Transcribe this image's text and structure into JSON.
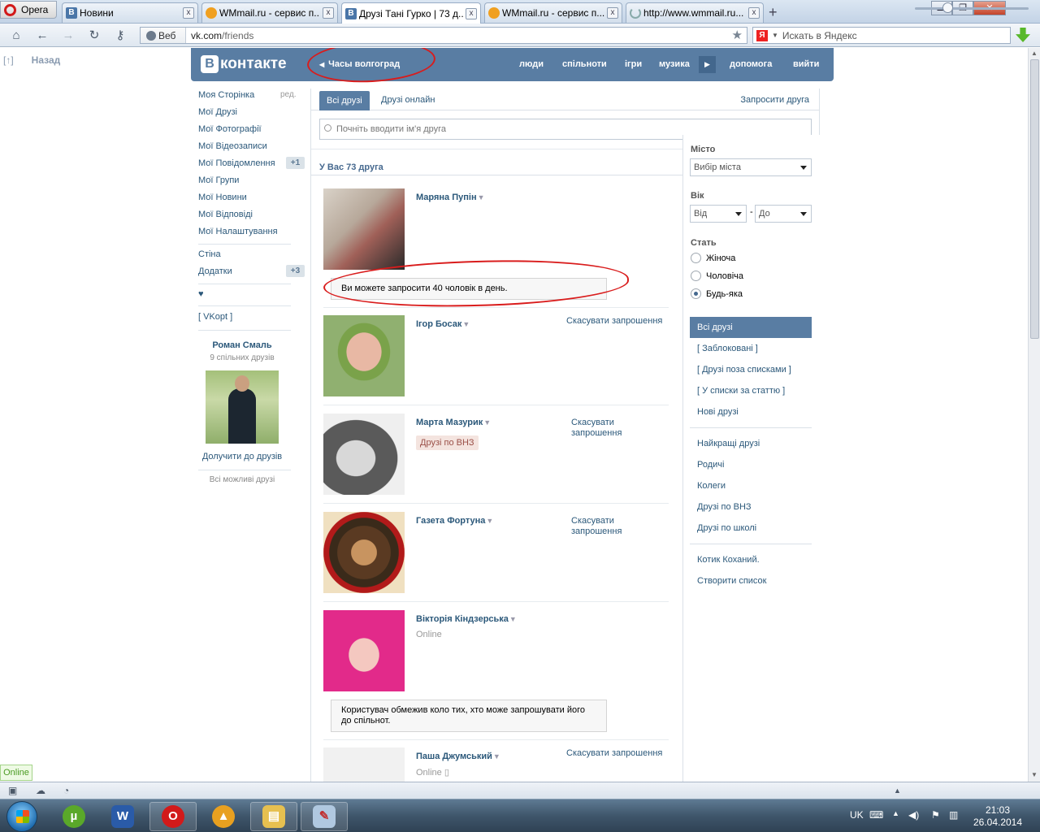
{
  "browser": {
    "menu_label": "Opera",
    "tabs": [
      {
        "label": "Новини",
        "favicon": "vk-icon"
      },
      {
        "label": "WMmail.ru - сервис п...",
        "favicon": "wmmail-icon"
      },
      {
        "label": "Друзі Тані Гурко | 73 д...",
        "favicon": "vk-icon",
        "active": true
      },
      {
        "label": "WMmail.ru - сервис п...",
        "favicon": "wmmail-icon"
      },
      {
        "label": "http://www.wmmail.ru...",
        "favicon": "loading-icon"
      }
    ],
    "new_tab": "+",
    "web_label": "Веб",
    "url_domain": "vk.com",
    "url_path": "/friends",
    "search_placeholder": "Искать в Яндекс",
    "close_glyph": "x"
  },
  "page": {
    "back_label": "Назад",
    "back_glyph": "[↑]",
    "header": {
      "logo_letter": "В",
      "logo_text": "контакте",
      "status": "Часы волгоград",
      "nav": [
        "люди",
        "спільноти",
        "ігри",
        "музика",
        "допомога",
        "вийти"
      ]
    },
    "left_menu": {
      "items": [
        "Моя Сторінка",
        "Мої Друзі",
        "Мої Фотографії",
        "Мої Відеозаписи",
        "Мої Повідомлення",
        "Мої Групи",
        "Мої Новини",
        "Мої Відповіді",
        "Мої Налаштування"
      ],
      "edit": "ред.",
      "messages_count": "+1",
      "wall": "Стіна",
      "apps": "Додатки",
      "apps_count": "+3",
      "heart": "♥",
      "vkopt": "[ VKopt ]"
    },
    "suggestion": {
      "name": "Роман Смаль",
      "mutual": "9 спільних друзів",
      "add": "Долучити до друзів",
      "all_possible": "Всі можливі друзі"
    },
    "main": {
      "tab_all": "Всі друзі",
      "tab_online": "Друзі онлайн",
      "invite": "Запросити друга",
      "search_placeholder": "Почніть вводити ім'я друга",
      "summary": "У Вас 73 друга",
      "cancel_request": "Скасувати запрошення",
      "cancel_request_line1": "Скасувати",
      "cancel_request_line2": "запрошення",
      "online": "Online",
      "uni_badge": "Друзі по ВНЗ",
      "notice_limit": "Ви можете запросити 40 чоловік в день.",
      "notice_restricted": "Користувач обмежив коло тих, хто може запрошувати його до спільнот.",
      "friends": [
        "Маряна Пупін",
        "Ігор Босак",
        "Марта Мазурик",
        "Газета Фортуна",
        "Вікторія Кіндзерська",
        "Паша Джумський"
      ]
    },
    "filters": {
      "city_label": "Місто",
      "city_select": "Вибір міста",
      "age_label": "Вік",
      "age_from": "Від",
      "age_dash": "-",
      "age_to": "До",
      "sex_label": "Стать",
      "sex_options": [
        "Жіноча",
        "Чоловіча",
        "Будь-яка"
      ],
      "sex_selected": "Будь-яка",
      "lists_selected": "Всі друзі",
      "lists": [
        "[ Заблоковані ]",
        "[ Друзі поза списками ]",
        "[ У списки за статтю ]",
        "Нові друзі"
      ],
      "lists2": [
        "Найкращі друзі",
        "Родичі",
        "Колеги",
        "Друзі по ВНЗ",
        "Друзі по школі"
      ],
      "lists3": [
        "Котик Коханий.",
        "Створити список"
      ]
    }
  },
  "statusbar": {
    "online_chip": "Online"
  },
  "taskbar": {
    "language": "UK",
    "time": "21:03",
    "date": "26.04.2014"
  },
  "colors": {
    "vk_blue": "#597da3",
    "link": "#2b587a",
    "annotation_red": "#d91c1c"
  }
}
